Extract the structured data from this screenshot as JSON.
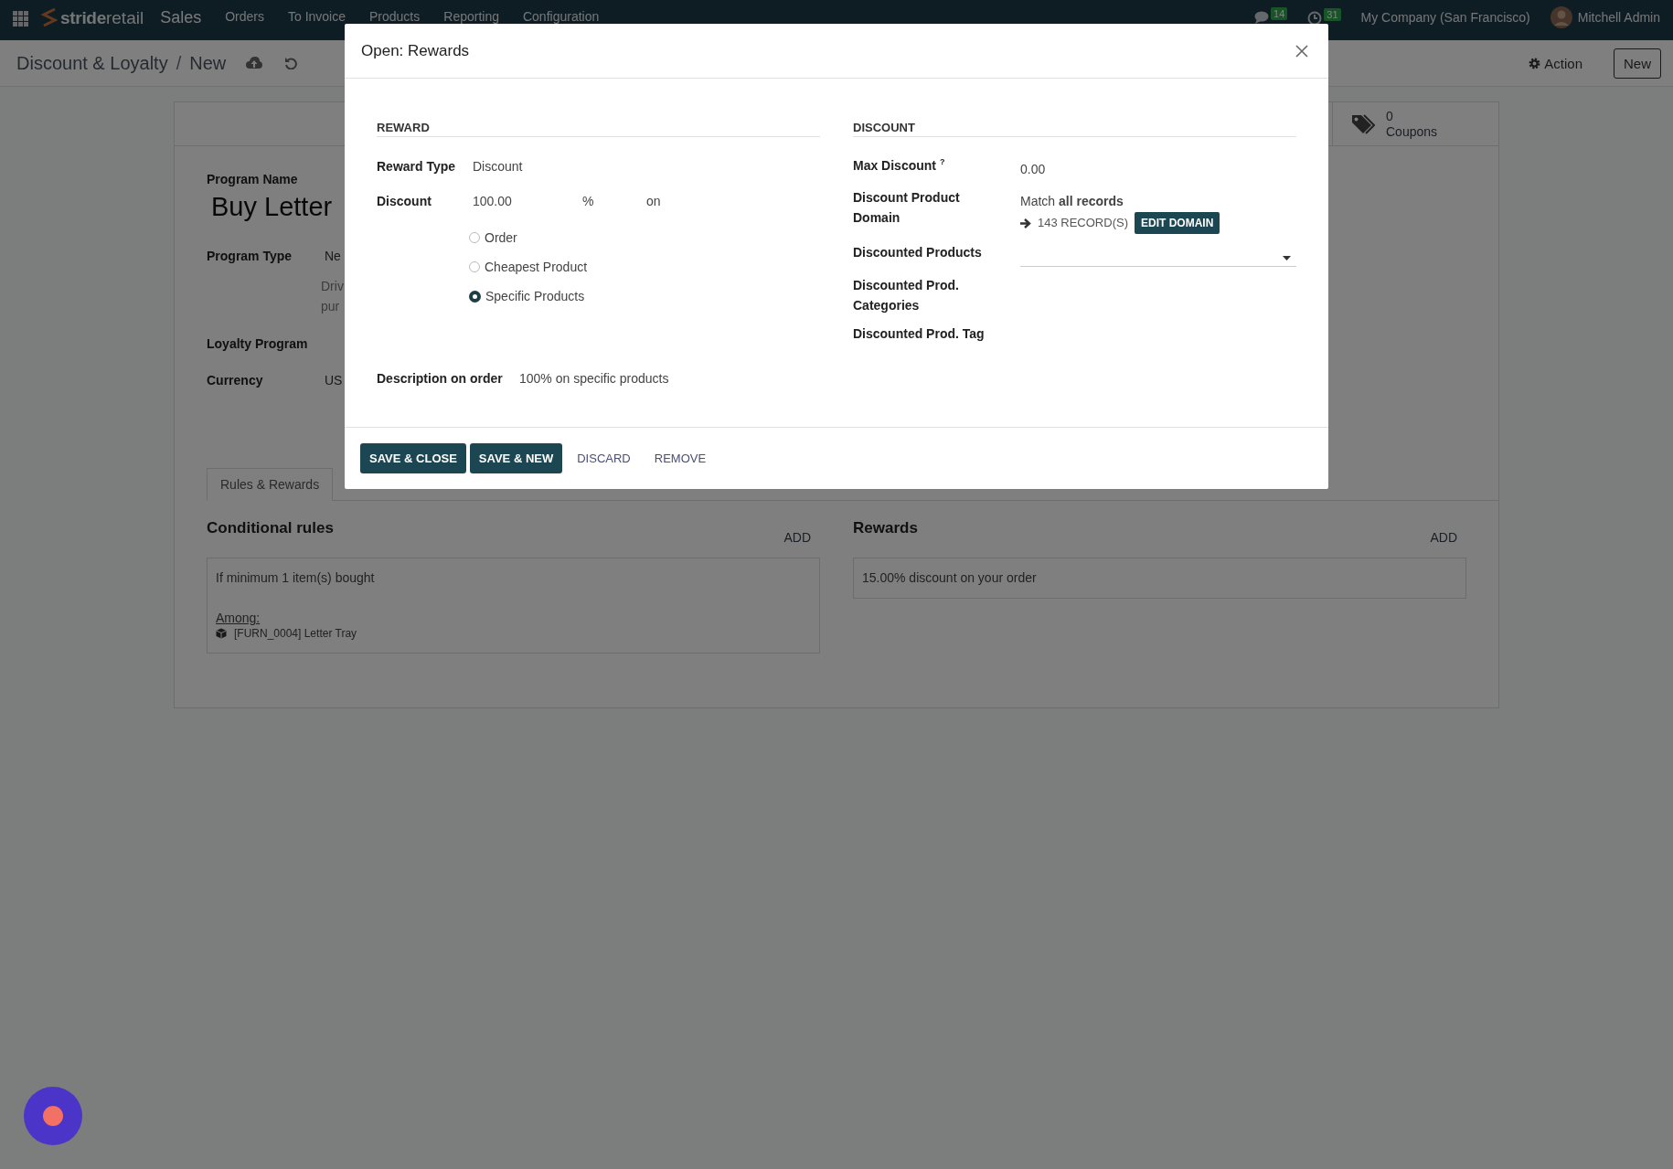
{
  "navbar": {
    "logo": [
      "stride",
      "retail"
    ],
    "app_name": "Sales",
    "menu": [
      {
        "label": "Orders"
      },
      {
        "label": "To Invoice"
      },
      {
        "label": "Products"
      },
      {
        "label": "Reporting"
      },
      {
        "label": "Configuration"
      }
    ],
    "messages_badge": "14",
    "activities_badge": "31",
    "company": "My Company (San Francisco)",
    "user": "Mitchell Admin"
  },
  "control_panel": {
    "breadcrumbs": [
      {
        "label": "Discount & Loyalty"
      },
      {
        "label": "New"
      }
    ],
    "separator": "/",
    "action": "Action",
    "new_button": "New"
  },
  "form": {
    "stat_button": {
      "value": "0",
      "label": "Coupons"
    },
    "program_name": {
      "label": "Program Name",
      "value": "Buy Letter"
    },
    "fields": [
      {
        "label": "Program Type",
        "value": "Ne",
        "help": [
          "Driv",
          "pur"
        ]
      },
      {
        "label": "Loyalty Program"
      },
      {
        "label": "Currency",
        "value": "US"
      }
    ],
    "tabs": [
      {
        "label": "Rules & Rewards",
        "selected": true
      }
    ],
    "conditional_rules": {
      "title": "Conditional rules",
      "add": "ADD",
      "items": [
        {
          "text": "If minimum 1 item(s) bought",
          "among_label": "Among:",
          "product": "[FURN_0004] Letter Tray"
        }
      ]
    },
    "rewards": {
      "title": "Rewards",
      "add": "ADD",
      "items": [
        {
          "text": "15.00% discount on your order"
        }
      ]
    }
  },
  "dialog": {
    "title": "Open: Rewards",
    "reward_section": {
      "heading": "REWARD",
      "reward_type": {
        "label": "Reward Type",
        "value": "Discount"
      },
      "discount": {
        "label": "Discount",
        "value": "100.00",
        "unit": "%",
        "suffix": "on"
      },
      "apply_on": [
        {
          "label": "Order",
          "selected": false
        },
        {
          "label": "Cheapest Product",
          "selected": false
        },
        {
          "label": "Specific Products",
          "selected": true
        }
      ],
      "description": {
        "label": "Description on order",
        "value": "100% on specific products"
      }
    },
    "discount_section": {
      "heading": "DISCOUNT",
      "fields": [
        {
          "kind": "value",
          "label": "Max Discount $^{?}$",
          "value": "0.00"
        },
        {
          "kind": "domain",
          "label": "Discount Product Domain",
          "summary": "Match **all records**",
          "records": "143 RECORD(S)",
          "button": "EDIT DOMAIN"
        },
        {
          "kind": "dropdown",
          "label": "Discounted Products"
        },
        {
          "kind": "empty",
          "label": "Discounted Prod. Categories"
        },
        {
          "kind": "empty",
          "label": "Discounted Prod. Tag"
        }
      ]
    },
    "buttons": [
      {
        "label": "SAVE & CLOSE",
        "kind": "primary"
      },
      {
        "label": "SAVE & NEW",
        "kind": "primary"
      },
      {
        "label": "DISCARD",
        "kind": "link"
      },
      {
        "label": "REMOVE",
        "kind": "link"
      }
    ]
  }
}
